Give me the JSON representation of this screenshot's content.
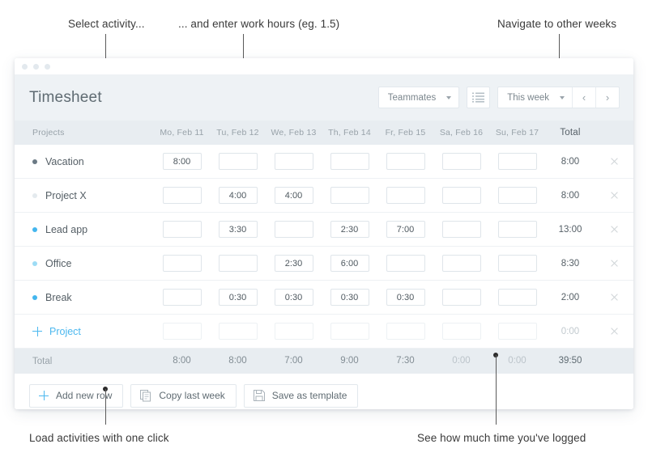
{
  "annotations": [
    {
      "id": "select-activity",
      "text": "Select activity..."
    },
    {
      "id": "enter-hours",
      "text": "... and enter work hours (eg. 1.5)"
    },
    {
      "id": "navigate-weeks",
      "text": "Navigate to other weeks"
    },
    {
      "id": "load-activities",
      "text": "Load activities with one click"
    },
    {
      "id": "time-logged",
      "text": "See how much time you've logged"
    }
  ],
  "header": {
    "title": "Timesheet",
    "teammates_label": "Teammates",
    "list_icon": "list-icon",
    "week_label": "This week",
    "prev_icon": "chevron-left-icon",
    "next_icon": "chevron-right-icon",
    "prev_glyph": "‹",
    "next_glyph": "›"
  },
  "table": {
    "columns": [
      "Projects",
      "Mo, Feb 11",
      "Tu, Feb 12",
      "We, Feb 13",
      "Th, Feb 14",
      "Fr, Feb 15",
      "Sa, Feb 16",
      "Su, Feb 17",
      "Total"
    ],
    "rows": [
      {
        "name": "Vacation",
        "color": "#6b7a85",
        "values": [
          "8:00",
          "",
          "",
          "",
          "",
          "",
          ""
        ],
        "total": "8:00"
      },
      {
        "name": "Project X",
        "color": "#e4eaee",
        "values": [
          "",
          "4:00",
          "4:00",
          "",
          "",
          "",
          ""
        ],
        "total": "8:00"
      },
      {
        "name": "Lead app",
        "color": "#44b6ee",
        "values": [
          "",
          "3:30",
          "",
          "2:30",
          "7:00",
          "",
          ""
        ],
        "total": "13:00"
      },
      {
        "name": "Office",
        "color": "#9ddcf5",
        "values": [
          "",
          "",
          "2:30",
          "6:00",
          "",
          "",
          ""
        ],
        "total": "8:30"
      },
      {
        "name": "Break",
        "color": "#44b6ee",
        "values": [
          "",
          "0:30",
          "0:30",
          "0:30",
          "0:30",
          "",
          ""
        ],
        "total": "2:00"
      }
    ],
    "add_row": {
      "label": "Project",
      "values": [
        "",
        "",
        "",
        "",
        "",
        "",
        ""
      ],
      "total": "0:00"
    },
    "total_row": {
      "label": "Total",
      "values": [
        "8:00",
        "8:00",
        "7:00",
        "9:00",
        "7:30",
        "0:00",
        "0:00"
      ],
      "total": "39:50"
    }
  },
  "footer": {
    "add_new_row": "Add new row",
    "copy_last_week": "Copy last week",
    "save_as_template": "Save as template"
  },
  "colors": {
    "accent": "#44b6ee",
    "header_bg": "#eef2f5",
    "table_header_bg": "#e8edf1"
  }
}
